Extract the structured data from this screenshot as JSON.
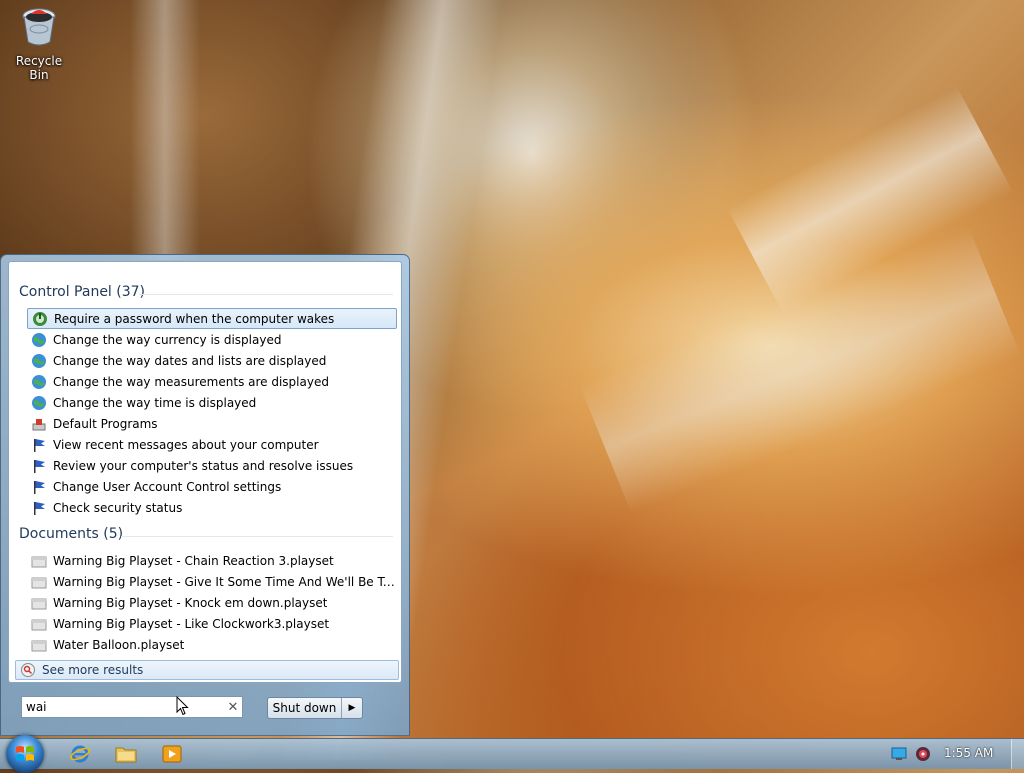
{
  "desktop": {
    "icons": [
      {
        "label": "Recycle Bin",
        "icon": "recycle-bin-icon"
      }
    ]
  },
  "start_menu": {
    "groups": [
      {
        "title": "Control Panel (37)",
        "items": [
          {
            "label": "Require a password when the computer wakes",
            "icon": "power-options-icon",
            "selected": true
          },
          {
            "label": "Change the way currency is displayed",
            "icon": "region-globe-icon"
          },
          {
            "label": "Change the way dates and lists are displayed",
            "icon": "region-globe-icon"
          },
          {
            "label": "Change the way measurements are displayed",
            "icon": "region-globe-icon"
          },
          {
            "label": "Change the way time is displayed",
            "icon": "region-globe-icon"
          },
          {
            "label": "Default Programs",
            "icon": "default-programs-icon"
          },
          {
            "label": "View recent messages about your computer",
            "icon": "action-center-flag-icon"
          },
          {
            "label": "Review your computer's status and resolve issues",
            "icon": "action-center-flag-icon"
          },
          {
            "label": "Change User Account Control settings",
            "icon": "action-center-flag-icon"
          },
          {
            "label": "Check security status",
            "icon": "action-center-flag-icon"
          }
        ]
      },
      {
        "title": "Documents (5)",
        "items": [
          {
            "label": "Warning Big Playset - Chain Reaction 3.playset",
            "icon": "document-icon"
          },
          {
            "label": "Warning Big Playset - Give It Some Time And We'll Be Togethe....",
            "icon": "document-icon"
          },
          {
            "label": "Warning Big Playset - Knock em down.playset",
            "icon": "document-icon"
          },
          {
            "label": "Warning Big Playset - Like Clockwork3.playset",
            "icon": "document-icon"
          },
          {
            "label": "Water Balloon.playset",
            "icon": "document-icon"
          }
        ]
      }
    ],
    "see_more": "See more results",
    "search": {
      "value": "wai",
      "clear_icon": "clear-icon"
    },
    "shutdown": {
      "label": "Shut down",
      "arrow_icon": "triangle-right-icon"
    }
  },
  "taskbar": {
    "pinned": [
      {
        "name": "internet-explorer",
        "icon": "internet-explorer-icon"
      },
      {
        "name": "windows-explorer",
        "icon": "folder-icon"
      },
      {
        "name": "media-player",
        "icon": "media-player-icon"
      }
    ],
    "tray": [
      {
        "name": "network",
        "icon": "monitor-icon"
      },
      {
        "name": "volume",
        "icon": "speaker-icon"
      }
    ],
    "clock": "1:55 AM"
  }
}
